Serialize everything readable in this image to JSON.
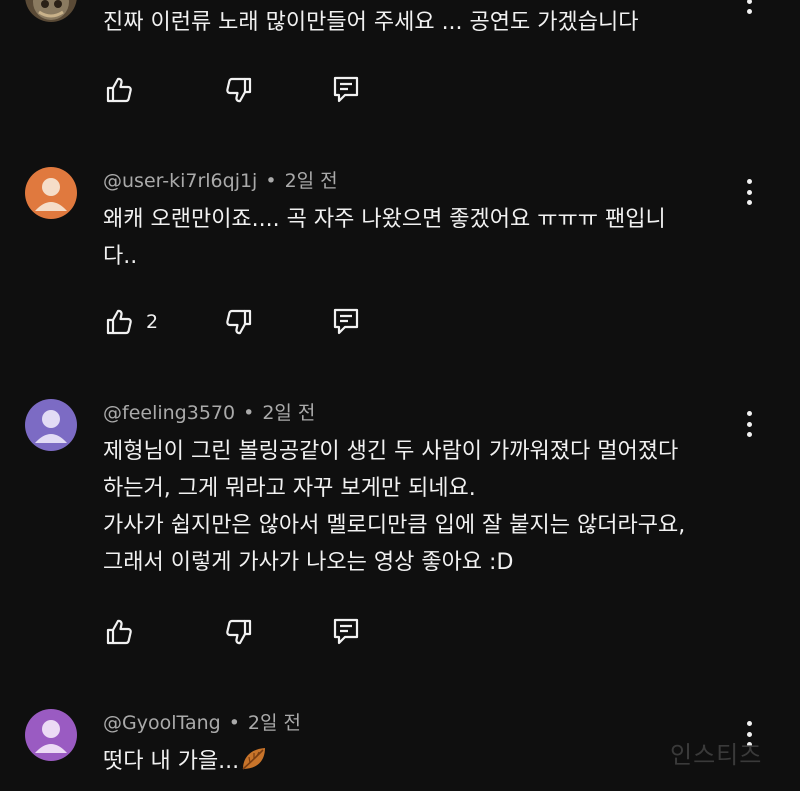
{
  "comments": [
    {
      "author": "",
      "time": "",
      "lines": [
        "진짜 이런류 노래 많이만들어 주세요 ... 공연도 가겠습니다"
      ],
      "likes": "",
      "avatar_color": "#8a7a60"
    },
    {
      "author": "@user-ki7rl6qj1j",
      "time": "2일 전",
      "lines": [
        "왜캐 오랜만이죠.... 곡 자주 나왔으면 좋겠어요 ㅠㅠㅠ 팬입니",
        "다.."
      ],
      "likes": "2",
      "avatar_color": "#e0793e"
    },
    {
      "author": "@feeling3570",
      "time": "2일 전",
      "lines": [
        "제형님이 그린 볼링공같이 생긴 두 사람이 가까워졌다 멀어졌다",
        "하는거, 그게 뭐라고 자꾸 보게만 되네요.",
        "가사가 쉽지만은 않아서 멜로디만큼 입에 잘 붙지는 않더라구요,",
        "그래서 이렇게 가사가 나오는 영상 좋아요 :D"
      ],
      "likes": "",
      "avatar_color": "#7c6bc4"
    },
    {
      "author": "@GyoolTang",
      "time": "2일 전",
      "lines": [
        "떳다 내 가을..."
      ],
      "likes": "",
      "avatar_color": "#9a5bc2"
    }
  ],
  "separator": "•",
  "icons": {
    "like": "thumbs-up-icon",
    "dislike": "thumbs-down-icon",
    "reply": "reply-comment-icon",
    "more": "more-vert-icon",
    "emoji": "fallen-leaf-emoji"
  },
  "watermark": "인스티즈"
}
